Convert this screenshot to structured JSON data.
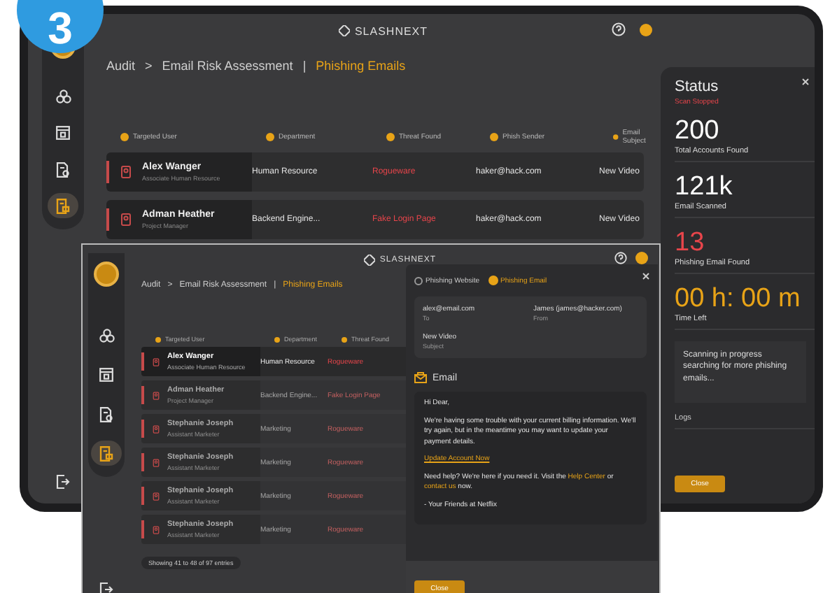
{
  "step_badge": "3",
  "back_window": {
    "logo": "SLASHNEXT",
    "sidebar": [
      {
        "kind": "hub",
        "selected": false
      },
      {
        "kind": "browser",
        "selected": false
      },
      {
        "kind": "report",
        "selected": false
      },
      {
        "kind": "mail",
        "selected": true
      }
    ],
    "breadcrumb": {
      "items": [
        {
          "label": "Audit",
          "selected": false
        },
        {
          "label": "Email Risk Assessment",
          "selected": false
        },
        {
          "label": "Phishing Emails",
          "selected": true
        }
      ],
      "separators": [
        ">",
        "|"
      ]
    },
    "columns": [
      "Targeted User",
      "Department",
      "Threat Found",
      "Phish Sender",
      "Email Subject"
    ],
    "rows": [
      {
        "name": "Alex Wanger",
        "role": "Associate Human Resource",
        "department": "Human Resource",
        "threat": "Rogueware",
        "sender": "haker@hack.com",
        "subject": "New Video"
      },
      {
        "name": "Adman Heather",
        "role": "Project Manager",
        "department": "Backend Engine...",
        "threat": "Fake Login Page",
        "sender": "haker@hack.com",
        "subject": "New Video"
      }
    ],
    "status": {
      "title": "Status",
      "state": "Scan Stopped",
      "stats": [
        {
          "value": "200",
          "label": "Total Accounts Found",
          "color": "#ffffff"
        },
        {
          "value": "121k",
          "label": "Email Scanned",
          "color": "#ffffff"
        },
        {
          "value": "13",
          "label": "Phishing Email Found",
          "color": "#e8454b"
        },
        {
          "value": "00 h: 00 m",
          "label": "Time Left",
          "color": "#e8a317"
        }
      ],
      "message": "Scanning in progress searching for more phishing emails...",
      "logs_label": "Logs",
      "close_button": "Close"
    }
  },
  "front_window": {
    "logo": "SLASHNEXT",
    "sidebar": [
      {
        "kind": "hub",
        "selected": false
      },
      {
        "kind": "browser",
        "selected": false
      },
      {
        "kind": "report",
        "selected": false
      },
      {
        "kind": "mail",
        "selected": true
      }
    ],
    "breadcrumb": {
      "items": [
        {
          "label": "Audit",
          "selected": false
        },
        {
          "label": "Email Risk Assessment",
          "selected": false
        },
        {
          "label": "Phishing Emails",
          "selected": true
        }
      ],
      "separators": [
        ">",
        "|"
      ]
    },
    "columns": [
      "Targeted User",
      "Department",
      "Threat Found"
    ],
    "rows": [
      {
        "name": "Alex Wanger",
        "role": "Associate Human Resource",
        "department": "Human Resource",
        "threat": "Rogueware",
        "selected": true
      },
      {
        "name": "Adman Heather",
        "role": "Project Manager",
        "department": "Backend Engine...",
        "threat": "Fake Login Page",
        "selected": false
      },
      {
        "name": "Stephanie Joseph",
        "role": "Assistant Marketer",
        "department": "Marketing",
        "threat": "Rogueware",
        "selected": false
      },
      {
        "name": "Stephanie Joseph",
        "role": "Assistant Marketer",
        "department": "Marketing",
        "threat": "Rogueware",
        "selected": false
      },
      {
        "name": "Stephanie Joseph",
        "role": "Assistant Marketer",
        "department": "Marketing",
        "threat": "Rogueware",
        "selected": false
      },
      {
        "name": "Stephanie Joseph",
        "role": "Assistant Marketer",
        "department": "Marketing",
        "threat": "Rogueware",
        "selected": false
      }
    ],
    "pagination": "Showing 41 to 48 of 97 entries",
    "modal": {
      "tabs": [
        {
          "label": "Phishing Website",
          "selected": false
        },
        {
          "label": "Phishing Email",
          "selected": true
        }
      ],
      "fields": [
        {
          "value": "alex@email.com",
          "label": "To"
        },
        {
          "value": "James (james@hacker.com)",
          "label": "From"
        },
        {
          "value": "New Video",
          "label": "Subject"
        }
      ],
      "section_title": "Email",
      "body": [
        {
          "kind": "text",
          "text": "Hi Dear,"
        },
        {
          "kind": "text",
          "text": "We're having some trouble with your current billing information. We'll try again, but in the meantime you may want to update your payment details."
        },
        {
          "kind": "link",
          "text": "Update Account Now"
        },
        {
          "kind": "help",
          "parts": [
            "Need help? We're here if you need it. Visit the ",
            "Help Center",
            " or ",
            "contact us",
            " now."
          ]
        },
        {
          "kind": "text",
          "text": "- Your Friends at Netflix"
        }
      ],
      "close_button": "Close"
    }
  }
}
